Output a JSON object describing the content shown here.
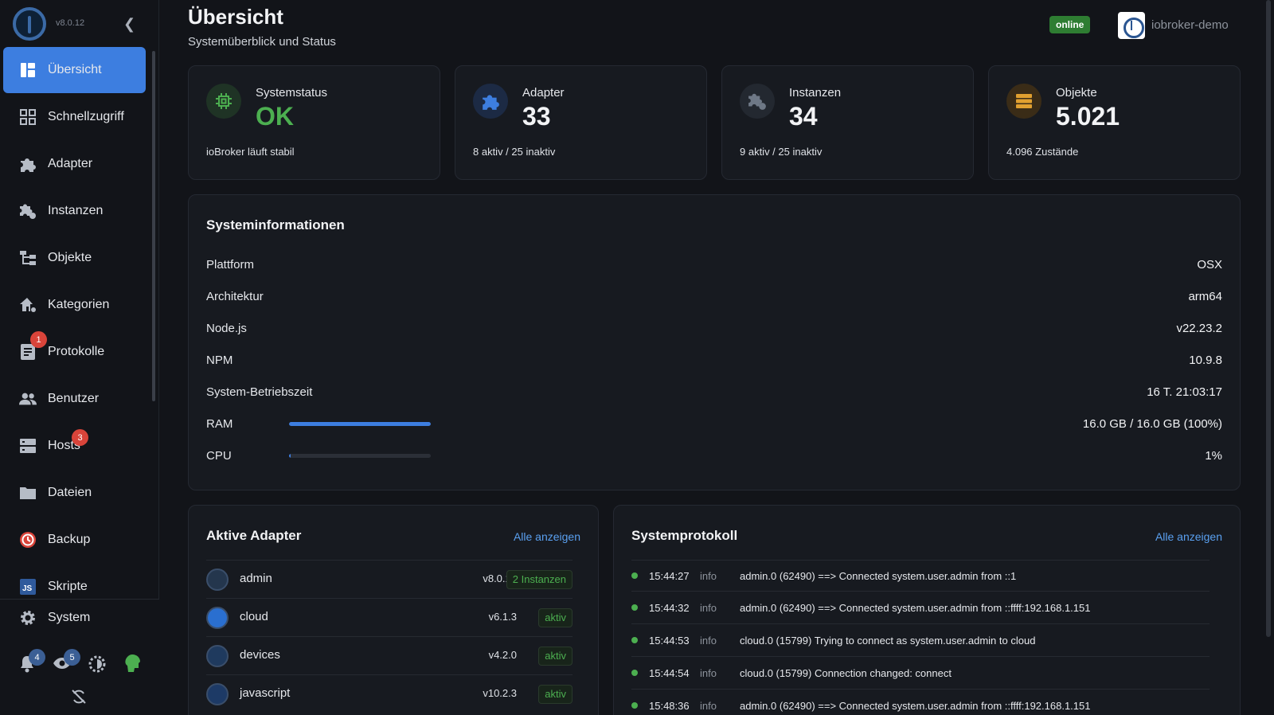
{
  "sidebar": {
    "version": "v8.0.12",
    "items": [
      {
        "label": "Übersicht"
      },
      {
        "label": "Schnellzugriff"
      },
      {
        "label": "Adapter"
      },
      {
        "label": "Instanzen"
      },
      {
        "label": "Objekte"
      },
      {
        "label": "Kategorien"
      },
      {
        "label": "Protokolle",
        "badge": "1"
      },
      {
        "label": "Benutzer"
      },
      {
        "label": "Hosts",
        "badge": "3"
      },
      {
        "label": "Dateien"
      },
      {
        "label": "Backup"
      },
      {
        "label": "Skripte"
      }
    ],
    "system_label": "System",
    "notifications_badge": "4",
    "watch_badge": "5"
  },
  "header": {
    "title": "Übersicht",
    "subtitle": "Systemüberblick und Status",
    "status": "online",
    "host": "iobroker-demo"
  },
  "stats": [
    {
      "label": "Systemstatus",
      "value": "OK",
      "sub": "ioBroker läuft stabil",
      "color": "#4caf50"
    },
    {
      "label": "Adapter",
      "value": "33",
      "sub": "8 aktiv / 25 inaktiv",
      "color": "#3d7ee0"
    },
    {
      "label": "Instanzen",
      "value": "34",
      "sub": "9 aktiv / 25 inaktiv",
      "color": "#5d6776"
    },
    {
      "label": "Objekte",
      "value": "5.021",
      "sub": "4.096 Zustände",
      "color": "#e0a030"
    }
  ],
  "sysinfo": {
    "title": "Systeminformationen",
    "rows": [
      {
        "label": "Plattform",
        "value": "OSX"
      },
      {
        "label": "Architektur",
        "value": "arm64"
      },
      {
        "label": "Node.js",
        "value": "v22.23.2"
      },
      {
        "label": "NPM",
        "value": "10.9.8"
      },
      {
        "label": "System-Betriebszeit",
        "value": "16 T. 21:03:17"
      },
      {
        "label": "RAM",
        "value": "16.0 GB / 16.0 GB (100%)",
        "progress": 100
      },
      {
        "label": "CPU",
        "value": "1%",
        "progress": 1
      }
    ]
  },
  "adapters": {
    "title": "Aktive Adapter",
    "link": "Alle anzeigen",
    "rows": [
      {
        "name": "admin",
        "version": "v8.0.12",
        "tag": "2 Instanzen"
      },
      {
        "name": "cloud",
        "version": "v6.1.3",
        "tag": "aktiv"
      },
      {
        "name": "devices",
        "version": "v4.2.0",
        "tag": "aktiv"
      },
      {
        "name": "javascript",
        "version": "v10.2.3",
        "tag": "aktiv"
      }
    ]
  },
  "log": {
    "title": "Systemprotokoll",
    "link": "Alle anzeigen",
    "rows": [
      {
        "time": "15:44:27",
        "level": "info",
        "message": "admin.0 (62490) ==> Connected system.user.admin from ::1"
      },
      {
        "time": "15:44:32",
        "level": "info",
        "message": "admin.0 (62490) ==> Connected system.user.admin from ::ffff:192.168.1.151"
      },
      {
        "time": "15:44:53",
        "level": "info",
        "message": "cloud.0 (15799) Trying to connect as system.user.admin to cloud"
      },
      {
        "time": "15:44:54",
        "level": "info",
        "message": "cloud.0 (15799) Connection changed: connect"
      },
      {
        "time": "15:48:36",
        "level": "info",
        "message": "admin.0 (62490) ==> Connected system.user.admin from ::ffff:192.168.1.151"
      }
    ]
  }
}
